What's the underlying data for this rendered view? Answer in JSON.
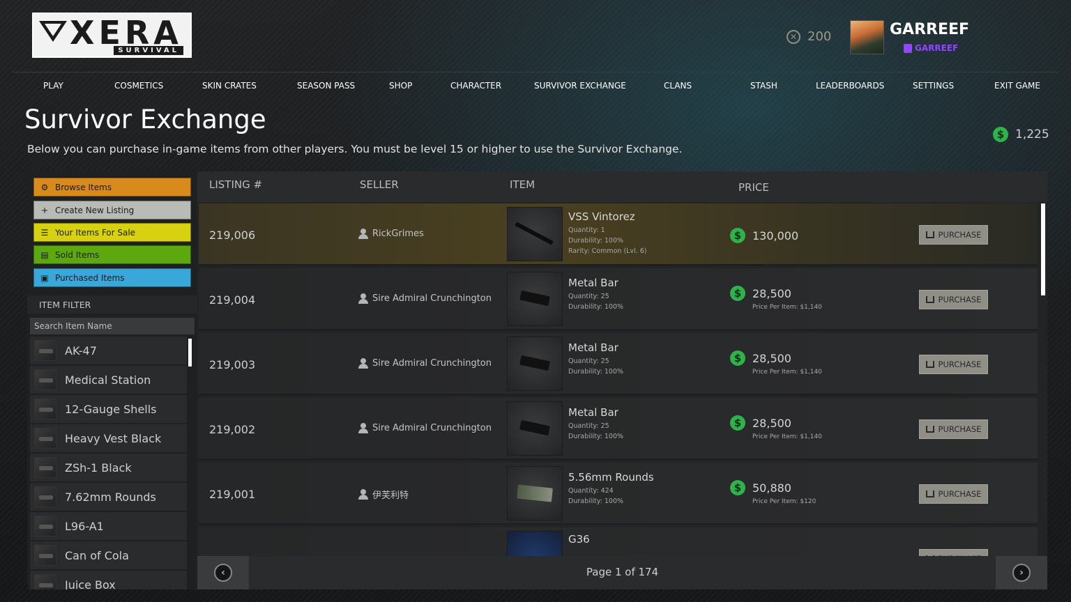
{
  "brand": {
    "word": "XERA",
    "sub": "SURVIVAL"
  },
  "user": {
    "coins": "200",
    "name": "GARREEF",
    "twitch": "GARREEF"
  },
  "nav": [
    "PLAY",
    "COSMETICS",
    "SKIN CRATES",
    "SEASON PASS",
    "SHOP",
    "CHARACTER",
    "SURVIVOR EXCHANGE",
    "CLANS",
    "STASH",
    "LEADERBOARDS",
    "SETTINGS",
    "EXIT GAME"
  ],
  "page": {
    "title": "Survivor Exchange",
    "description": "Below you can purchase in-game items from other players. You must be level 15 or higher to use the Survivor Exchange.",
    "balance": "1,225"
  },
  "sidebar": {
    "buttons": [
      {
        "label": "Browse Items",
        "color": "#d98a1c",
        "icon": "⚙"
      },
      {
        "label": "Create New Listing",
        "color": "#b9bcb6",
        "icon": "+"
      },
      {
        "label": "Your Items For Sale",
        "color": "#d8d10f",
        "icon": "☰"
      },
      {
        "label": "Sold Items",
        "color": "#5ea80f",
        "icon": "▤"
      },
      {
        "label": "Purchased Items",
        "color": "#3aa7d9",
        "icon": "▣"
      }
    ],
    "filter_label": "ITEM FILTER",
    "search_placeholder": "Search Item Name",
    "items": [
      "AK-47",
      "Medical Station",
      "12-Gauge Shells",
      "Heavy Vest Black",
      "ZSh-1 Black",
      "7.62mm Rounds",
      "L96-A1",
      "Can of Cola",
      "Juice Box"
    ]
  },
  "table": {
    "headers": {
      "listing": "LISTING #",
      "seller": "SELLER",
      "item": "ITEM",
      "price": "PRICE"
    },
    "purchase_label": "PURCHASE",
    "rows": [
      {
        "listing": "219,006",
        "seller": "RickGrimes",
        "name": "VSS Vintorez",
        "meta": [
          "Quantity: 1",
          "Durability: 100%",
          "Rarity: Common (Lvl. 6)"
        ],
        "price": "130,000",
        "ppi": ""
      },
      {
        "listing": "219,004",
        "seller": "Sire Admiral Crunchington",
        "name": "Metal Bar",
        "meta": [
          "Quantity: 25",
          "Durability: 100%"
        ],
        "price": "28,500",
        "ppi": "Price Per Item: $1,140"
      },
      {
        "listing": "219,003",
        "seller": "Sire Admiral Crunchington",
        "name": "Metal Bar",
        "meta": [
          "Quantity: 25",
          "Durability: 100%"
        ],
        "price": "28,500",
        "ppi": "Price Per Item: $1,140"
      },
      {
        "listing": "219,002",
        "seller": "Sire Admiral Crunchington",
        "name": "Metal Bar",
        "meta": [
          "Quantity: 25",
          "Durability: 100%"
        ],
        "price": "28,500",
        "ppi": "Price Per Item: $1,140"
      },
      {
        "listing": "219,001",
        "seller": "伊芙利特",
        "name": "5.56mm Rounds",
        "meta": [
          "Quantity: 424",
          "Durability: 100%"
        ],
        "price": "50,880",
        "ppi": "Price Per Item: $120"
      },
      {
        "listing": "",
        "seller": "",
        "name": "G36",
        "meta": [],
        "price": "",
        "ppi": ""
      }
    ],
    "pagination": "Page 1 of 174"
  }
}
